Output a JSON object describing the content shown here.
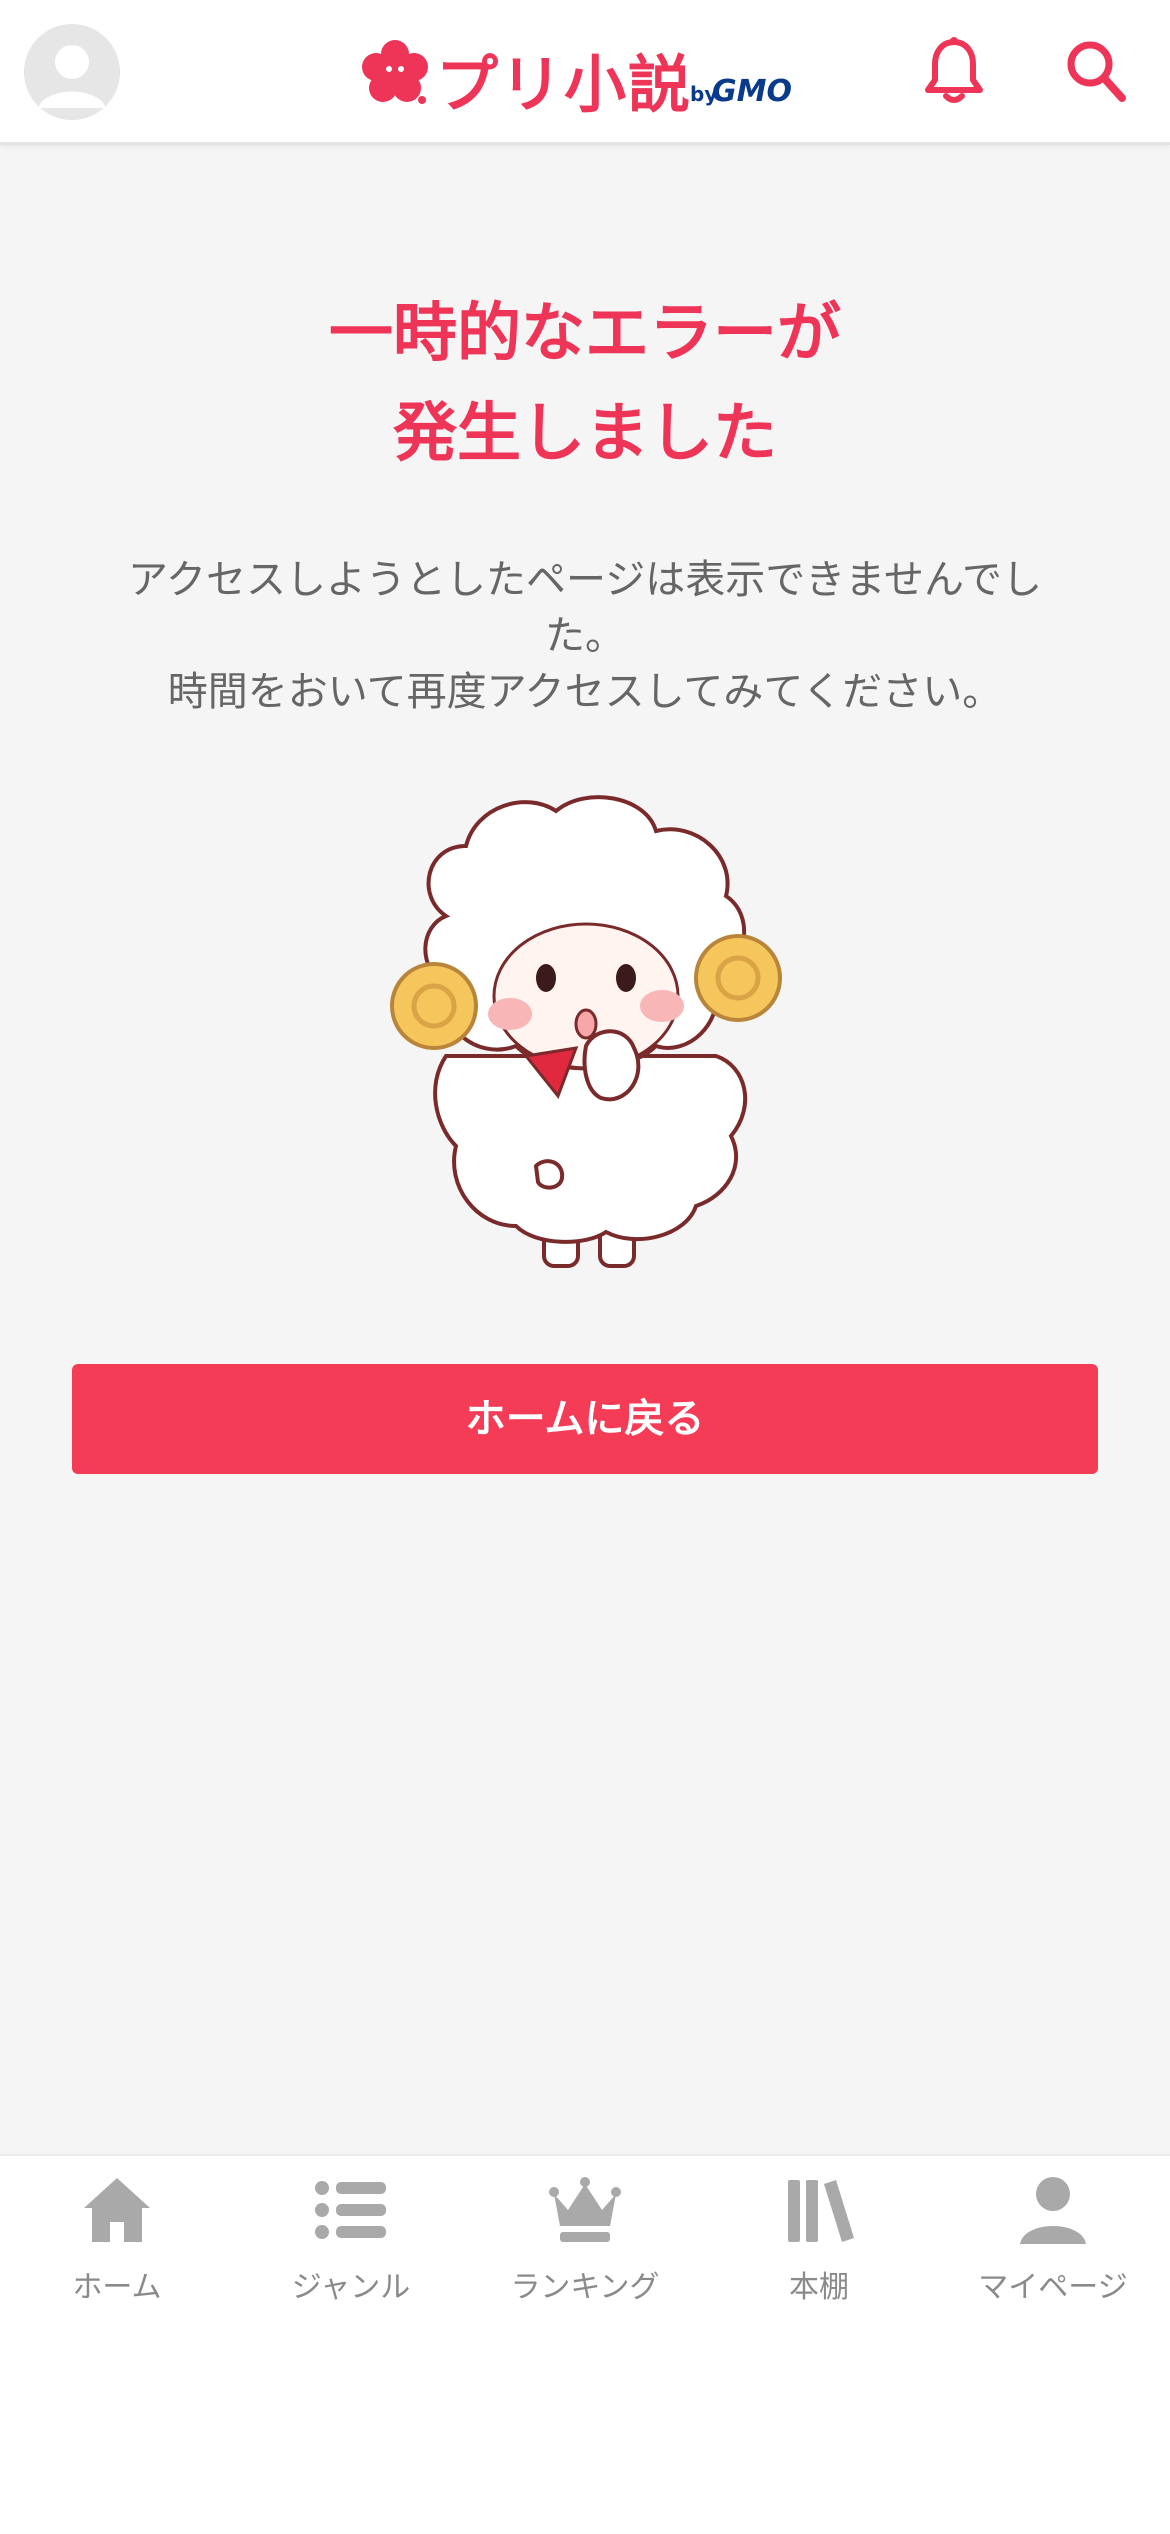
{
  "header": {
    "logo_text": "プリ小説",
    "logo_by": "by",
    "logo_gmo": "GMO",
    "avatar_icon": "user-avatar-icon",
    "notification_icon": "bell-icon",
    "search_icon": "search-icon"
  },
  "error": {
    "title_line1": "一時的なエラーが",
    "title_line2": "発生しました",
    "message_line1": "アクセスしようとしたページは表示できませんでし",
    "message_line2": "た。",
    "message_line3": "時間をおいて再度アクセスしてみてください。"
  },
  "home_button_label": "ホームに戻る",
  "tabs": [
    {
      "label": "ホーム",
      "icon": "home-icon"
    },
    {
      "label": "ジャンル",
      "icon": "list-icon"
    },
    {
      "label": "ランキング",
      "icon": "crown-icon"
    },
    {
      "label": "本棚",
      "icon": "bookshelf-icon"
    },
    {
      "label": "マイページ",
      "icon": "person-icon"
    }
  ],
  "colors": {
    "accent": "#ee3558",
    "button": "#f43c57",
    "tab_icon": "#a9a9a9",
    "background": "#f5f5f5"
  }
}
